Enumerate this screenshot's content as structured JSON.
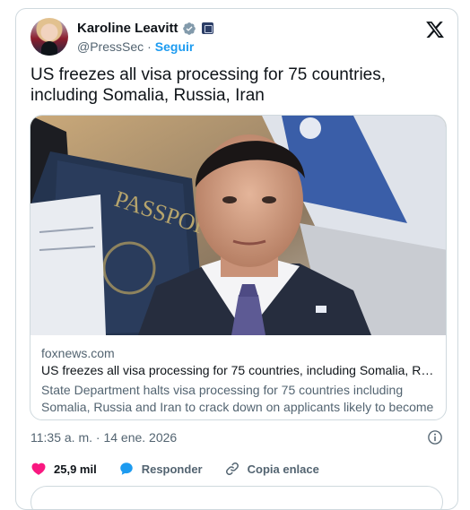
{
  "author": {
    "display_name": "Karoline Leavitt",
    "handle": "@PressSec",
    "separator": "·",
    "follow_label": "Seguir"
  },
  "tweet": {
    "text": "US freezes all visa processing for 75 countries, including Somalia, Russia, Iran"
  },
  "link_card": {
    "domain": "foxnews.com",
    "title": "US freezes all visa processing for 75 countries, including Somalia, Russia,...",
    "description": "State Department halts visa processing for 75 countries including Somalia, Russia and Iran to crack down on applicants likely to become public ...",
    "image_text": {
      "passport": "PASSPORT"
    }
  },
  "meta": {
    "timestamp": "11:35 a. m. · 14 ene. 2026"
  },
  "actions": {
    "like_count": "25,9 mil",
    "reply_label": "Responder",
    "copy_label": "Copia enlace"
  },
  "icons": {
    "verified": "verified-badge-icon",
    "government": "government-affiliation-icon",
    "x_logo": "x-logo-icon",
    "info": "info-icon",
    "heart": "heart-icon",
    "reply": "reply-bubble-icon",
    "link": "link-icon"
  },
  "colors": {
    "accent": "#1d9bf0",
    "like": "#f91880",
    "text": "#0f1419",
    "muted": "#536471",
    "border": "#cfd9de"
  }
}
